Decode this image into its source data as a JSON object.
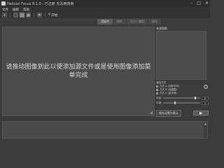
{
  "window": {
    "title": "Helicon Focus 8.1.0 - 已注册 无法用商用",
    "minimize": "–",
    "maximize": "□",
    "close": "✕"
  },
  "menu": {
    "items": [
      "文件",
      "编辑",
      "帮助"
    ]
  },
  "toolbar": {
    "render_label": "开始"
  },
  "tabs": [
    {
      "label": "渲染中",
      "active": true
    },
    {
      "label": "修饰",
      "active": false
    },
    {
      "label": "大小 / 裁剪",
      "active": false
    },
    {
      "label": "保存",
      "active": false
    }
  ],
  "drop_area": {
    "message": "请推动图像到此以便添加源文件或是使用图像添加菜单完成",
    "grip": "◢"
  },
  "right_panel": {
    "title": "来源图像",
    "options_title": "渲染方式",
    "methods": [
      {
        "label": "方式 A (加权平均)",
        "selected": false
      },
      {
        "label": "方式 B (深度图)",
        "selected": true
      },
      {
        "label": "方式 C (金字塔)",
        "selected": false
      }
    ],
    "radius_label": "半径:",
    "radius_value": "8",
    "smoothing_label": "平滑:",
    "smoothing_value": "4",
    "radius_fraction": 0.85,
    "smoothing_fraction": 0.3,
    "help": "?"
  },
  "bottom": {
    "save_label": "保存设置为默认",
    "go_label": "▶"
  },
  "log": {
    "scroll": "▲"
  }
}
